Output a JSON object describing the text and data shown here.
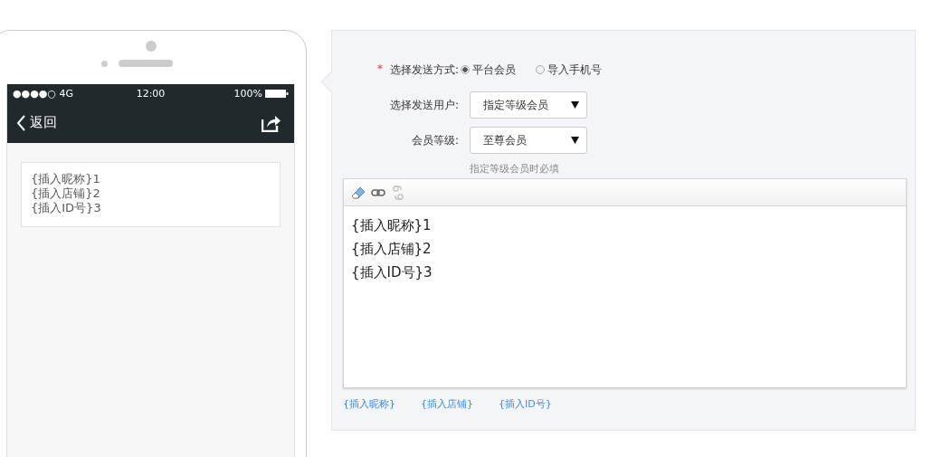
{
  "phone": {
    "status": {
      "carrier": "●●●●○ 4G",
      "time": "12:00",
      "battery": "100%"
    },
    "nav": {
      "back": "返回"
    },
    "message_lines": [
      "{插入昵称}1",
      "{插入店铺}2",
      "{插入ID号}3"
    ]
  },
  "form": {
    "send_method": {
      "label": "选择发送方式:",
      "required_mark": "*",
      "options": [
        {
          "label": "平台会员",
          "selected": true
        },
        {
          "label": "导入手机号",
          "selected": false
        }
      ]
    },
    "selects": [
      {
        "label": "选择发送用户:",
        "value": "指定等级会员"
      },
      {
        "label": "会员等级:",
        "value": "至尊会员",
        "hint": "指定等级会员时必填"
      }
    ],
    "editor": {
      "tools": [
        {
          "kind": "eraser",
          "disabled": false
        },
        {
          "kind": "link",
          "disabled": false
        },
        {
          "kind": "unlink",
          "disabled": true
        }
      ],
      "lines": [
        "{插入昵称}1",
        "{插入店铺}2",
        "{插入ID号}3"
      ]
    },
    "insert_links": [
      "{插入昵称}",
      "{插入店铺}",
      "{插入ID号}"
    ]
  }
}
